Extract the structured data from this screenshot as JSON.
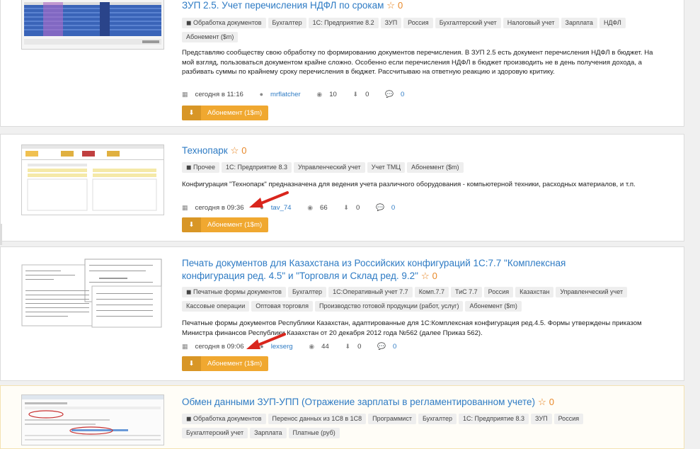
{
  "items": [
    {
      "title": "ЗУП 2.5. Учет перечисления НДФЛ по срокам",
      "rating": "0",
      "tags": [
        "Обработка документов",
        "Бухгалтер",
        "1С: Предприятие 8.2",
        "ЗУП",
        "Россия",
        "Бухгалтерский учет",
        "Налоговый учет",
        "Зарплата",
        "НДФЛ",
        "Абонемент ($m)"
      ],
      "description": "Представляю сообществу свою обработку по формированию документов перечисления. В ЗУП 2.5 есть документ перечисления НДФЛ в бюджет. На мой взгляд, пользоваться документом крайне сложно. Особенно если перечисления НДФЛ в бюджет производить не в день получения дохода, а разбивать суммы по крайнему сроку перечисления в бюджет. Рассчитываю на ответную реакцию и здоровую критику.",
      "date": "сегодня в 11:16",
      "user": "mrflatcher",
      "views": "10",
      "downloads": "0",
      "comments": "0",
      "button": "Абонемент (1$m)"
    },
    {
      "title": "Технопарк",
      "rating": "0",
      "tags": [
        "Прочее",
        "1С: Предприятие 8.3",
        "Управленческий учет",
        "Учет ТМЦ",
        "Абонемент ($m)"
      ],
      "description": "Конфигурация \"Технопарк\" предназначена для ведения учета различного оборудования - компьютерной техники, расходных материалов, и т.п.",
      "date": "сегодня в 09:36",
      "user": "tav_74",
      "views": "66",
      "downloads": "0",
      "comments": "0",
      "button": "Абонемент (1$m)"
    },
    {
      "title": "Печать документов для Казахстана из Российских конфигураций 1С:7.7 \"Комплексная конфигурация ред. 4.5\" и \"Торговля и Склад ред. 9.2\"",
      "rating": "0",
      "tags": [
        "Печатные формы документов",
        "Бухгалтер",
        "1С:Оперативный учет 7.7",
        "Комп.7.7",
        "ТиС 7.7",
        "Россия",
        "Казахстан",
        "Управленческий учет",
        "Кассовые операции",
        "Оптовая торговля",
        "Производство готовой продукции (работ, услуг)",
        "Абонемент ($m)"
      ],
      "description": "Печатные формы документов Республики Казахстан, адаптированные для 1С:Комплексная конфигурация ред.4.5. Формы утверждены приказом Министра финансов Республики Казахстан от 20 декабря 2012 года №562 (далее Приказ 562).",
      "date": "сегодня в 09:06",
      "user": "lexserg",
      "views": "44",
      "downloads": "0",
      "comments": "0",
      "button": "Абонемент (1$m)"
    },
    {
      "title": "Обмен данными ЗУП-УПП (Отражение зарплаты в регламентированном учете)",
      "rating": "0",
      "tags": [
        "Обработка документов",
        "Перенос данных из 1С8 в 1С8",
        "Программист",
        "Бухгалтер",
        "1С: Предприятие 8.3",
        "ЗУП",
        "Россия",
        "Бухгалтерский учет",
        "Зарплата",
        "Платные (руб)"
      ]
    }
  ],
  "icons": {
    "star": "star-outline-icon",
    "calendar": "calendar-icon",
    "user": "user-icon",
    "eye": "eye-icon",
    "download": "download-icon",
    "comment": "comment-icon",
    "arrow": "red-arrow-icon"
  },
  "colors": {
    "link": "#2e7bc4",
    "star": "#e8892a",
    "button": "#f0a830",
    "arrow": "#d9251c"
  }
}
